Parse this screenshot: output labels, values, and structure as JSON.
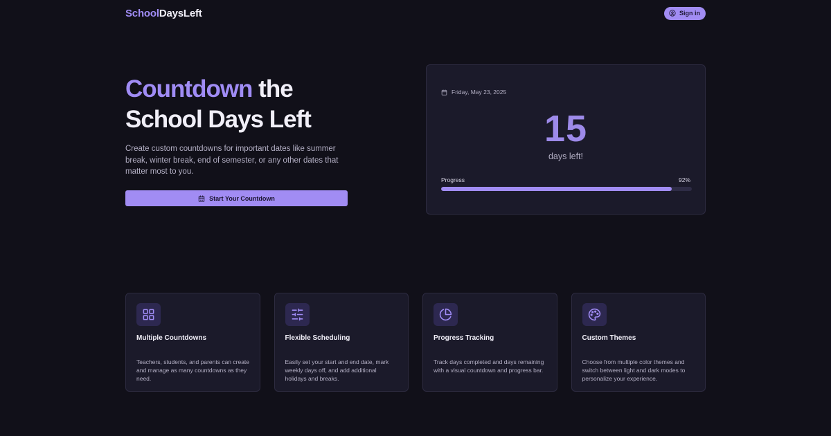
{
  "header": {
    "logo_part1": "School",
    "logo_part2": "DaysLeft",
    "signin_label": "Sign in",
    "signin_icon": "user-circle-icon"
  },
  "hero": {
    "title_accent": "Countdown",
    "title_rest_line1": " the",
    "title_line2": "School Days Left",
    "description": "Create custom countdowns for important dates like summer break, winter break, end of semester, or any other dates that matter most to you.",
    "cta_label": "Start Your Countdown",
    "cta_icon": "calendar-icon"
  },
  "countdown": {
    "date": "Friday, May 23, 2025",
    "date_icon": "calendar-icon",
    "days_number": "15",
    "days_label": "days left!",
    "progress_label": "Progress",
    "progress_text": "92%",
    "progress_fraction": 0.92
  },
  "features": [
    {
      "icon": "grid-icon",
      "title": "Multiple Countdowns",
      "description": "Teachers, students, and parents can create and manage as many countdowns as they need."
    },
    {
      "icon": "sliders-icon",
      "title": "Flexible Scheduling",
      "description": "Easily set your start and end date, mark weekly days off, and add additional holidays and breaks."
    },
    {
      "icon": "pie-chart-icon",
      "title": "Progress Tracking",
      "description": "Track days completed and days remaining with a visual countdown and progress bar."
    },
    {
      "icon": "palette-icon",
      "title": "Custom Themes",
      "description": "Choose from multiple color themes and switch between light and dark modes to personalize your experience."
    }
  ],
  "colors": {
    "background": "#111019",
    "accent": "#a18cf3",
    "card": "#1b1a2a"
  }
}
